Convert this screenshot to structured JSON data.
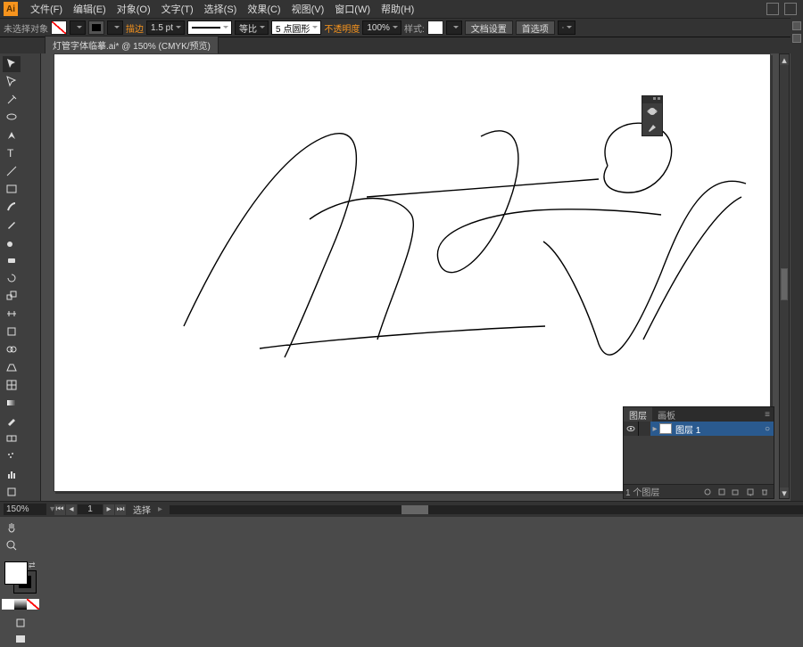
{
  "menubar": {
    "items": [
      "文件(F)",
      "编辑(E)",
      "对象(O)",
      "文字(T)",
      "选择(S)",
      "效果(C)",
      "视图(V)",
      "窗口(W)",
      "帮助(H)"
    ]
  },
  "controlbar": {
    "no_selection": "未选择对象",
    "stroke_label": "描边",
    "stroke_weight": "1.5 pt",
    "stroke_style": "等比",
    "corner_points": "5 点圆形",
    "opacity_label": "不透明度",
    "opacity_value": "100%",
    "style_label": "样式:",
    "doc_setup": "文档设置",
    "preferences": "首选项"
  },
  "tab": {
    "title": "灯管字体临摹.ai* @ 150% (CMYK/预览)"
  },
  "layers": {
    "tab_layers": "图层",
    "tab_artboards": "画板",
    "layer_name": "图层 1",
    "footer_count": "1 个图层"
  },
  "statusbar": {
    "zoom": "150%",
    "page": "1",
    "tool_label": "选择"
  }
}
